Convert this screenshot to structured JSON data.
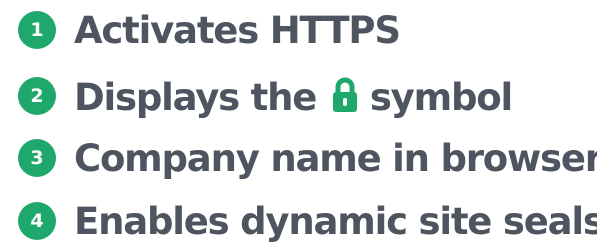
{
  "features": [
    {
      "number": "1",
      "text": "Activates HTTPS"
    },
    {
      "number": "2",
      "text_before": "Displays the",
      "icon": "padlock-icon",
      "text_after": "symbol"
    },
    {
      "number": "3",
      "text": "Company name in browser"
    },
    {
      "number": "4",
      "text": "Enables dynamic site seals"
    }
  ],
  "colors": {
    "badge": "#1ea86b",
    "text": "#4f5560",
    "lock": "#1ea86b"
  }
}
